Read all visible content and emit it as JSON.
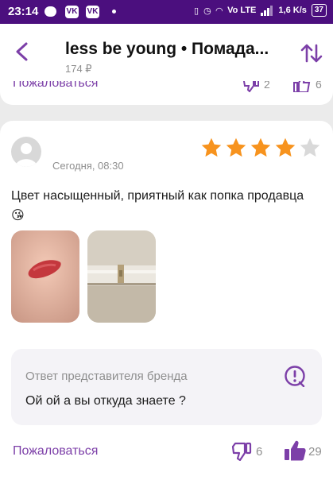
{
  "status_bar": {
    "time": "23:14",
    "app_icon_1": "vk-icon",
    "app_icon_1_text": "VK",
    "app_icon_2_text": "VK",
    "network_label": "Vo LTE",
    "speed": "1,6 K/s",
    "battery": "37"
  },
  "header": {
    "title": "less be young • Помада...",
    "price": "174 ₽",
    "back_icon": "chevron-left-icon",
    "sort_icon": "sort-arrows-icon",
    "accent": "#7c3fa8"
  },
  "previous_review": {
    "report_label": "Пожаловаться",
    "dislike_count": "2",
    "like_count": "6"
  },
  "review": {
    "date": "Сегодня, 08:30",
    "rating": 4,
    "rating_max": 5,
    "star_color": "#f7931e",
    "star_empty_color": "#d9d9d9",
    "text": "Цвет насыщенный, приятный как попка продавца 😘",
    "photos": [
      "lipstick-swatch-photo",
      "lipstick-product-photo"
    ],
    "brand_reply": {
      "label": "Ответ представителя бренда",
      "text": "Ой ой а вы откуда знаете ?",
      "icon": "alert-circle-icon"
    },
    "report_label": "Пожаловаться",
    "dislike_count": "6",
    "like_count": "29"
  }
}
